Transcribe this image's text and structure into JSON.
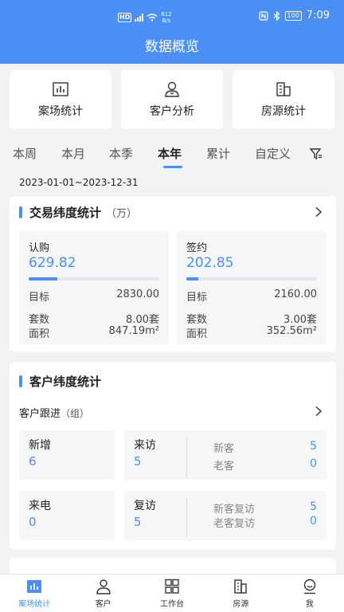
{
  "status_bar": {
    "hd": "HD",
    "net_speed_value": "612",
    "net_speed_unit": "B/s",
    "battery": "100",
    "time": "7:09"
  },
  "page_title": "数据概览",
  "quick_actions": [
    {
      "label": "案场统计",
      "icon": "bar-chart-icon"
    },
    {
      "label": "客户分析",
      "icon": "person-icon"
    },
    {
      "label": "房源统计",
      "icon": "building-icon"
    }
  ],
  "period_tabs": [
    "本周",
    "本月",
    "本季",
    "本年",
    "累计",
    "自定义"
  ],
  "active_period": "本年",
  "date_range": "2023-01-01~2023-12-31",
  "trade": {
    "title": "交易纬度统计",
    "unit": "（万）",
    "subscribe": {
      "label": "认购",
      "value": "629.82",
      "progress": 0.222,
      "target_label": "目标",
      "target": "2830.00",
      "count_label": "套数",
      "count": "8.00套",
      "area_label": "面积",
      "area": "847.19m²"
    },
    "sign": {
      "label": "签约",
      "value": "202.85",
      "progress": 0.094,
      "target_label": "目标",
      "target": "2160.00",
      "count_label": "套数",
      "count": "3.00套",
      "area_label": "面积",
      "area": "352.56m²"
    }
  },
  "customer": {
    "title": "客户纬度统计",
    "follow_label": "客户跟进",
    "follow_unit": "（组）",
    "new": {
      "label": "新增",
      "value": "6"
    },
    "visit": {
      "label": "来访",
      "value": "5",
      "new_label": "新客",
      "new_value": "5",
      "old_label": "老客",
      "old_value": "0"
    },
    "call": {
      "label": "来电",
      "value": "0"
    },
    "revisit": {
      "label": "复访",
      "value": "5",
      "new_label": "新客复访",
      "new_value": "5",
      "old_label": "老客复访",
      "old_value": "0"
    }
  },
  "bottom_nav": [
    {
      "label": "案场统计",
      "icon": "bar-chart-icon",
      "active": true
    },
    {
      "label": "客户",
      "icon": "person-icon",
      "active": false
    },
    {
      "label": "工作台",
      "icon": "grid-icon",
      "active": false
    },
    {
      "label": "房源",
      "icon": "building-icon",
      "active": false
    },
    {
      "label": "我",
      "icon": "profile-icon",
      "active": false
    }
  ],
  "colors": {
    "accent": "#4b8ff5",
    "background": "#f2f3f5"
  }
}
